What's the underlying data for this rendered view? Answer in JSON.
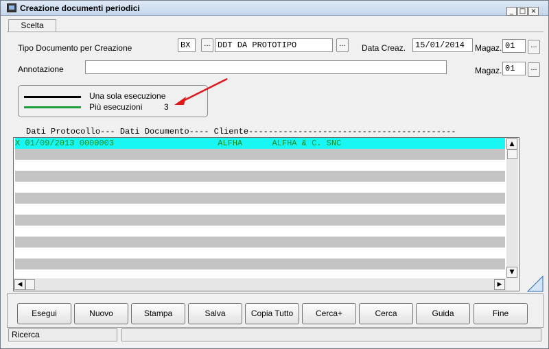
{
  "window": {
    "title": "Creazione documenti periodici"
  },
  "window_controls": {
    "minimize": "_",
    "maximize": "□",
    "close": "×"
  },
  "tab": {
    "label": "Scelta"
  },
  "form": {
    "tipo_label": "Tipo Documento per Creazione",
    "tipo_code": "BX",
    "tipo_desc": "DDT DA PROTOTIPO",
    "lookup_label": "...",
    "data_label": "Data Creaz.",
    "data_value": "15/01/2014",
    "magaz1_label": "Magaz.",
    "magaz1_value": "01",
    "annotazione_label": "Annotazione",
    "annotazione_value": "",
    "magaz2_label": "Magaz.",
    "magaz2_value": "01"
  },
  "legend": {
    "single_label": "Una sola esecuzione",
    "multi_label": "Più esecuzioni",
    "multi_count": "3",
    "single_color": "#000000",
    "multi_color": "#1a9e3a",
    "arrow_color": "#e01818"
  },
  "grid": {
    "header": "Dati Protocollo--- Dati Documento---- Cliente------------------------------------------",
    "rows": [
      {
        "text": "X 01/09/2013 0000003                     ALFHA      ALFHA & C. SNC",
        "selected": true
      },
      {
        "text": ""
      },
      {
        "text": ""
      },
      {
        "text": ""
      },
      {
        "text": ""
      },
      {
        "text": ""
      },
      {
        "text": ""
      },
      {
        "text": ""
      },
      {
        "text": ""
      },
      {
        "text": ""
      },
      {
        "text": ""
      },
      {
        "text": ""
      },
      {
        "text": ""
      }
    ],
    "scroll_up_icon": "▲",
    "scroll_down_icon": "▼",
    "scroll_left_icon": "◀",
    "scroll_right_icon": "▶"
  },
  "buttons": [
    {
      "label": "Esegui"
    },
    {
      "label": "Nuovo"
    },
    {
      "label": "Stampa"
    },
    {
      "label": "Salva"
    },
    {
      "label": "Copia Tutto"
    },
    {
      "label": "Cerca+"
    },
    {
      "label": "Cerca"
    },
    {
      "label": "Guida"
    },
    {
      "label": "Fine"
    }
  ],
  "status": {
    "left": "Ricerca",
    "right": ""
  }
}
